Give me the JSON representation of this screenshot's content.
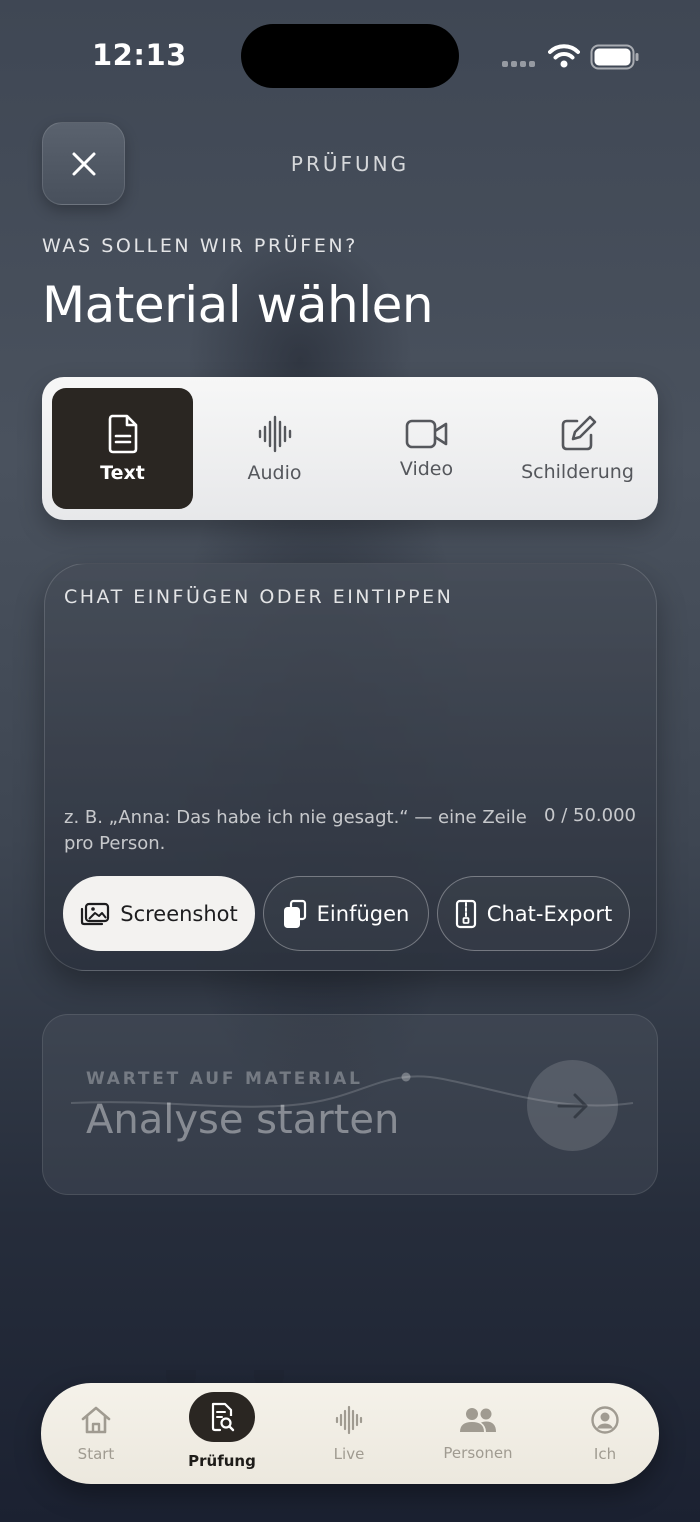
{
  "status_bar": {
    "time": "12:13"
  },
  "header": {
    "title": "PRÜFUNG",
    "close_icon": "close-icon"
  },
  "intro": {
    "eyebrow": "WAS SOLLEN WIR PRÜFEN?",
    "title": "Material wählen"
  },
  "material_types": {
    "selected": "Text",
    "items": [
      {
        "label": "Text",
        "icon": "document-icon"
      },
      {
        "label": "Audio",
        "icon": "waveform-icon"
      },
      {
        "label": "Video",
        "icon": "video-camera-icon"
      },
      {
        "label": "Schilderung",
        "icon": "compose-icon"
      }
    ]
  },
  "chat_input": {
    "heading": "CHAT EINFÜGEN ODER EINTIPPEN",
    "placeholder": "z. B. „Anna: Das habe ich nie gesagt.“ — eine Zeile pro Person.",
    "counter": "0 / 50.000",
    "actions": [
      {
        "label": "Screenshot",
        "icon": "photos-icon"
      },
      {
        "label": "Einfügen",
        "icon": "paste-icon"
      },
      {
        "label": "Chat-Export",
        "icon": "zip-file-icon"
      }
    ]
  },
  "analyse": {
    "eyebrow": "WARTET AUF MATERIAL",
    "title": "Analyse starten",
    "icon": "arrow-right-icon"
  },
  "tab_bar": {
    "active": "Prüfung",
    "items": [
      {
        "label": "Start",
        "icon": "house-icon"
      },
      {
        "label": "Prüfung",
        "icon": "document-search-icon"
      },
      {
        "label": "Live",
        "icon": "waveform-icon"
      },
      {
        "label": "Personen",
        "icon": "people-icon"
      },
      {
        "label": "Ich",
        "icon": "person-circle-icon"
      }
    ]
  },
  "colors": {
    "accent_dark": "#2a2622",
    "surface_light": "#f3f2f0",
    "tab_bar": "#f5f2ea"
  }
}
